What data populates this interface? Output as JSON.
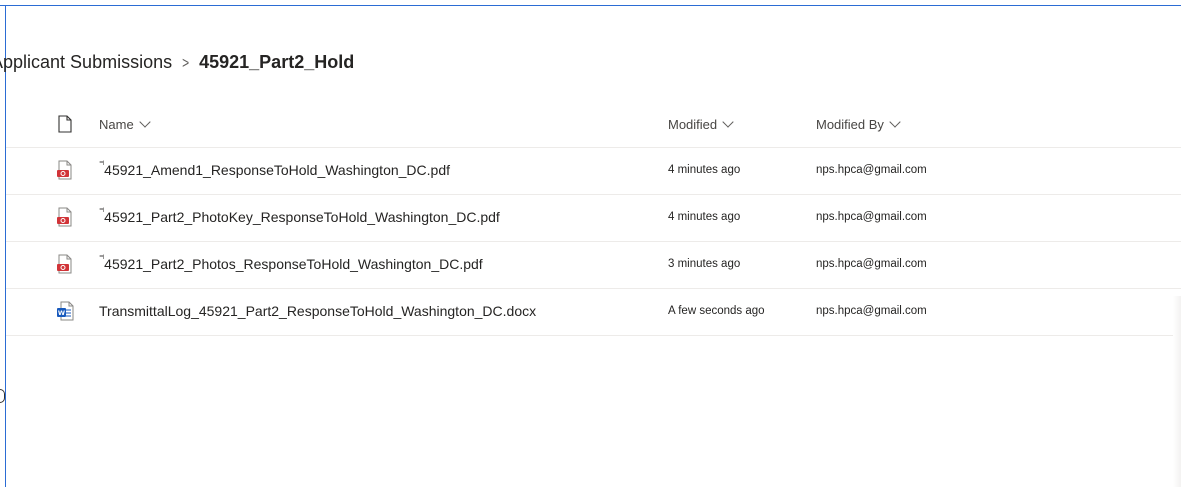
{
  "breadcrumb": {
    "parent": "Applicant Submissions",
    "separator": ">",
    "current": "45921_Part2_Hold"
  },
  "columns": {
    "type_icon": "document-icon",
    "name": "Name",
    "modified": "Modified",
    "modified_by": "Modified By"
  },
  "files": [
    {
      "icon": "pdf-icon",
      "name": "45921_Amend1_ResponseToHold_Washington_DC.pdf",
      "new_indicator": true,
      "modified": "4 minutes ago",
      "modified_by": "nps.hpca@gmail.com"
    },
    {
      "icon": "pdf-icon",
      "name": "45921_Part2_PhotoKey_ResponseToHold_Washington_DC.pdf",
      "new_indicator": true,
      "modified": "4 minutes ago",
      "modified_by": "nps.hpca@gmail.com"
    },
    {
      "icon": "pdf-icon",
      "name": "45921_Part2_Photos_ResponseToHold_Washington_DC.pdf",
      "new_indicator": true,
      "modified": "3 minutes ago",
      "modified_by": "nps.hpca@gmail.com"
    },
    {
      "icon": "word-icon",
      "name": "TransmittalLog_45921_Part2_ResponseToHold_Washington_DC.docx",
      "new_indicator": false,
      "modified": "A few seconds ago",
      "modified_by": "nps.hpca@gmail.com"
    }
  ],
  "colors": {
    "frame_border": "#2b6cd4",
    "pdf_red": "#d13438",
    "word_blue": "#185abd",
    "row_divider": "#edebe9"
  }
}
